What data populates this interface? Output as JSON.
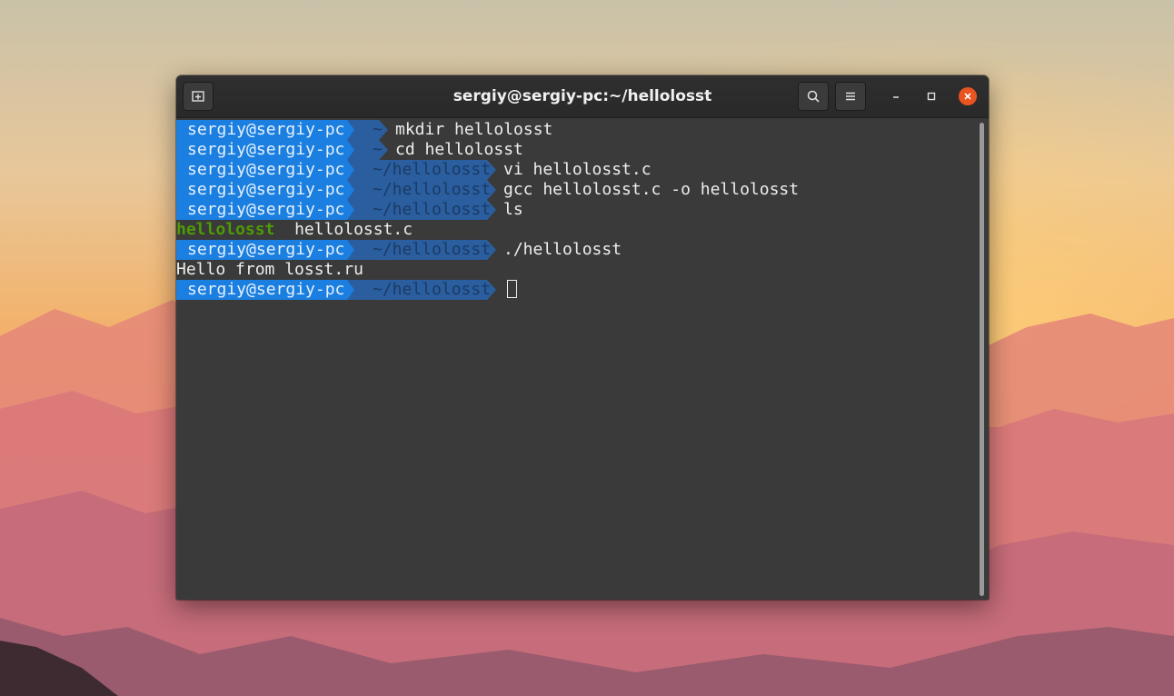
{
  "window": {
    "title": "sergiy@sergiy-pc:~/hellolosst",
    "icons": {
      "new_tab": "new-tab-icon",
      "search": "search-icon",
      "menu": "hamburger-menu-icon",
      "minimize": "minimize-icon",
      "maximize": "maximize-icon",
      "close": "close-icon"
    },
    "accent_close": "#e95420"
  },
  "colors": {
    "prompt_user_bg": "#1a7fe0",
    "prompt_dir_bg": "#2a5e9e",
    "dir_listing": "#4e9a06",
    "terminal_bg": "#3a3a3a"
  },
  "terminal": {
    "lines": [
      {
        "type": "prompt",
        "user": "sergiy@sergiy-pc",
        "dir": "~",
        "cmd": "mkdir hellolosst"
      },
      {
        "type": "prompt",
        "user": "sergiy@sergiy-pc",
        "dir": "~",
        "cmd": "cd hellolosst"
      },
      {
        "type": "prompt",
        "user": "sergiy@sergiy-pc",
        "dir": "~/hellolosst",
        "cmd": "vi hellolosst.c"
      },
      {
        "type": "prompt",
        "user": "sergiy@sergiy-pc",
        "dir": "~/hellolosst",
        "cmd": "gcc hellolosst.c -o hellolosst"
      },
      {
        "type": "prompt",
        "user": "sergiy@sergiy-pc",
        "dir": "~/hellolosst",
        "cmd": "ls"
      },
      {
        "type": "listing",
        "items": [
          {
            "text": "hellolosst",
            "kind": "dir"
          },
          {
            "text": "hellolosst.c",
            "kind": "file"
          }
        ]
      },
      {
        "type": "prompt",
        "user": "sergiy@sergiy-pc",
        "dir": "~/hellolosst",
        "cmd": "./hellolosst"
      },
      {
        "type": "output",
        "text": "Hello from losst.ru"
      },
      {
        "type": "prompt",
        "user": "sergiy@sergiy-pc",
        "dir": "~/hellolosst",
        "cmd": "",
        "cursor": true
      }
    ]
  }
}
